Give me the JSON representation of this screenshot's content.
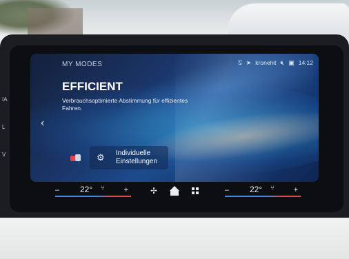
{
  "screen": {
    "section_label": "MY MODES",
    "mode_title": "EFFICIENT",
    "mode_description": "Verbrauchsoptimierte Abstimmung für effizientes Fahren.",
    "individual_settings_button": {
      "line1": "Individuelle",
      "line2": "Einstellungen",
      "icon": "gear-icon"
    }
  },
  "status_bar": {
    "station": "kronehit",
    "time": "14:12",
    "icons": [
      "notification-icon",
      "navigation-arrow-icon",
      "mute-icon",
      "media-icon"
    ]
  },
  "left_edge_labels": [
    "IA",
    "L",
    "V"
  ],
  "climate": {
    "left": {
      "minus": "–",
      "temp": "22°",
      "plus": "+"
    },
    "right": {
      "minus": "–",
      "temp": "22°",
      "plus": "+"
    },
    "center_icons": [
      "fan-icon",
      "home-icon",
      "apps-grid-icon"
    ],
    "accent_cold": "#3f8bf0",
    "accent_warm": "#e74848"
  }
}
